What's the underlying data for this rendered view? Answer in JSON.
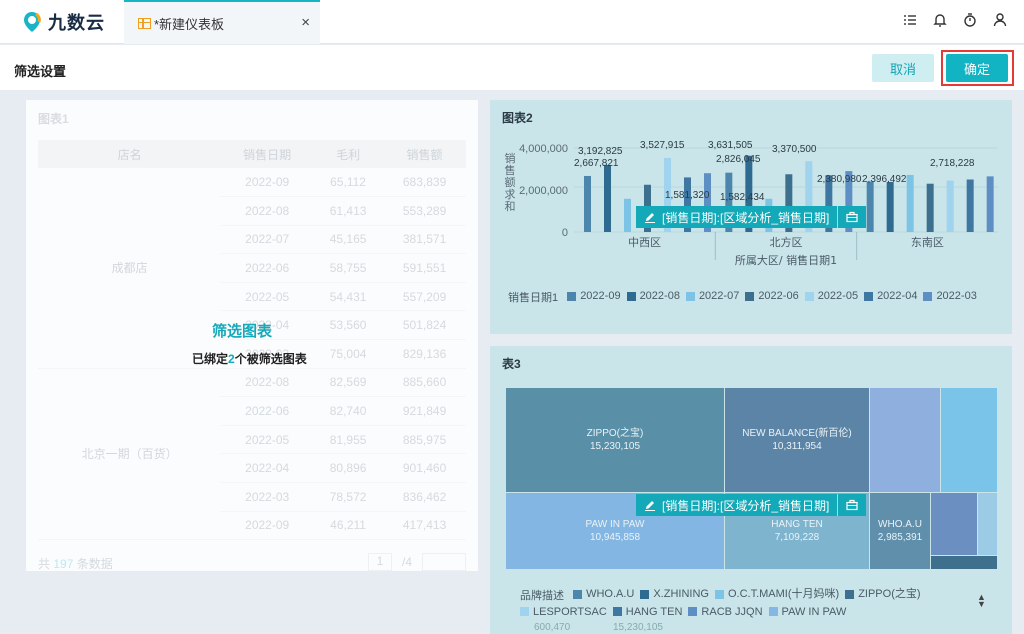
{
  "app": {
    "brand": "九数云"
  },
  "tab": {
    "title": "*新建仪表板",
    "close": "×"
  },
  "filter_bar": {
    "title": "筛选设置",
    "cancel_label": "取消",
    "confirm_label": "确定"
  },
  "left_panel": {
    "title": "图表1",
    "columns": [
      "店名",
      "销售日期",
      "毛利",
      "销售额"
    ],
    "groups": [
      {
        "store": "成都店",
        "rows": [
          [
            "2022-09",
            "65,112",
            "683,839"
          ],
          [
            "2022-08",
            "61,413",
            "553,289"
          ],
          [
            "2022-07",
            "45,165",
            "381,571"
          ],
          [
            "2022-06",
            "58,755",
            "591,551"
          ],
          [
            "2022-05",
            "54,431",
            "557,209"
          ],
          [
            "2022-04",
            "53,560",
            "501,824"
          ],
          [
            "2022-03",
            "75,004",
            "829,136"
          ]
        ]
      },
      {
        "store": "北京一期（百货）",
        "rows": [
          [
            "2022-08",
            "82,569",
            "885,660"
          ],
          [
            "2022-06",
            "82,740",
            "921,849"
          ],
          [
            "2022-05",
            "81,955",
            "885,975"
          ],
          [
            "2022-04",
            "80,896",
            "901,460"
          ],
          [
            "2022-03",
            "78,572",
            "836,462"
          ],
          [
            "2022-09",
            "46,211",
            "417,413"
          ]
        ]
      }
    ],
    "overlay_title": "筛选图表",
    "overlay_pre": "已绑定",
    "overlay_num": "2",
    "overlay_post": "个被筛选图表",
    "pager": {
      "prefix": "共",
      "count": "197",
      "suffix": "条数据",
      "page": "1",
      "total": "/4"
    }
  },
  "filter_tag": {
    "label": "[销售日期]:[区域分析_销售日期]"
  },
  "chart_panel": {
    "title": "图表2",
    "chart_data": {
      "type": "bar",
      "categories": [
        "中西区",
        "北方区",
        "东南区"
      ],
      "series": [
        {
          "name": "2022-09",
          "values": [
            2667821,
            2826045,
            2396492
          ]
        },
        {
          "name": "2022-08",
          "values": [
            3192825,
            3631505,
            2380980
          ]
        },
        {
          "name": "2022-07",
          "values": [
            1581320,
            1582434,
            2718228
          ]
        },
        {
          "name": "2022-06",
          "values": [
            2250000,
            2750000,
            2300000
          ]
        },
        {
          "name": "2022-05",
          "values": [
            3527915,
            3370500,
            2450000
          ]
        },
        {
          "name": "2022-04",
          "values": [
            2600000,
            2700000,
            2500000
          ]
        },
        {
          "name": "2022-03",
          "values": [
            2800000,
            2900000,
            2650000
          ]
        }
      ],
      "data_labels": [
        "3,192,825",
        "2,667,821",
        "3,527,915",
        "1,581,320",
        "3,631,505",
        "2,826,045",
        "1,582,434",
        "3,370,500",
        "2,380,980",
        "2,396,492",
        "2,718,228"
      ],
      "yticks": [
        "4,000,000",
        "2,000,000",
        "0"
      ],
      "ylim": [
        0,
        4000000
      ],
      "ylabel": "销售额求和",
      "xlabel": "所属大区/ 销售日期1",
      "legend_title": "销售日期1",
      "colors": [
        "#4c86ad",
        "#2f6b91",
        "#7cc3e6",
        "#3d6f8f",
        "#9fd3ee",
        "#3f77a3",
        "#5e8fc4"
      ]
    }
  },
  "treemap_panel": {
    "title": "表3",
    "cells": [
      {
        "name": "ZIPPO(之宝)",
        "value": "15,230,105"
      },
      {
        "name": "NEW BALANCE(新百伦)",
        "value": "10,311,954"
      },
      {
        "name": "PAW IN PAW",
        "value": "10,945,858"
      },
      {
        "name": "HANG TEN",
        "value": "7,109,228"
      },
      {
        "name": "WHO.A.U",
        "value": "2,985,391"
      }
    ],
    "legend_title": "品牌描述",
    "legend": [
      "WHO.A.U",
      "X.ZHINING",
      "O.C.T.MAMI(十月妈咪)",
      "ZIPPO(之宝)",
      "LESPORTSAC",
      "HANG TEN",
      "RACB JJQN",
      "PAW IN PAW"
    ],
    "legend_colors": [
      "#4c86ad",
      "#2f6b91",
      "#7cc3e6",
      "#3d6f8f",
      "#9fd3ee",
      "#3f77a3",
      "#5e8fc4",
      "#86b6e4"
    ],
    "bottom_values": [
      "600,470",
      "15,230,105"
    ]
  }
}
